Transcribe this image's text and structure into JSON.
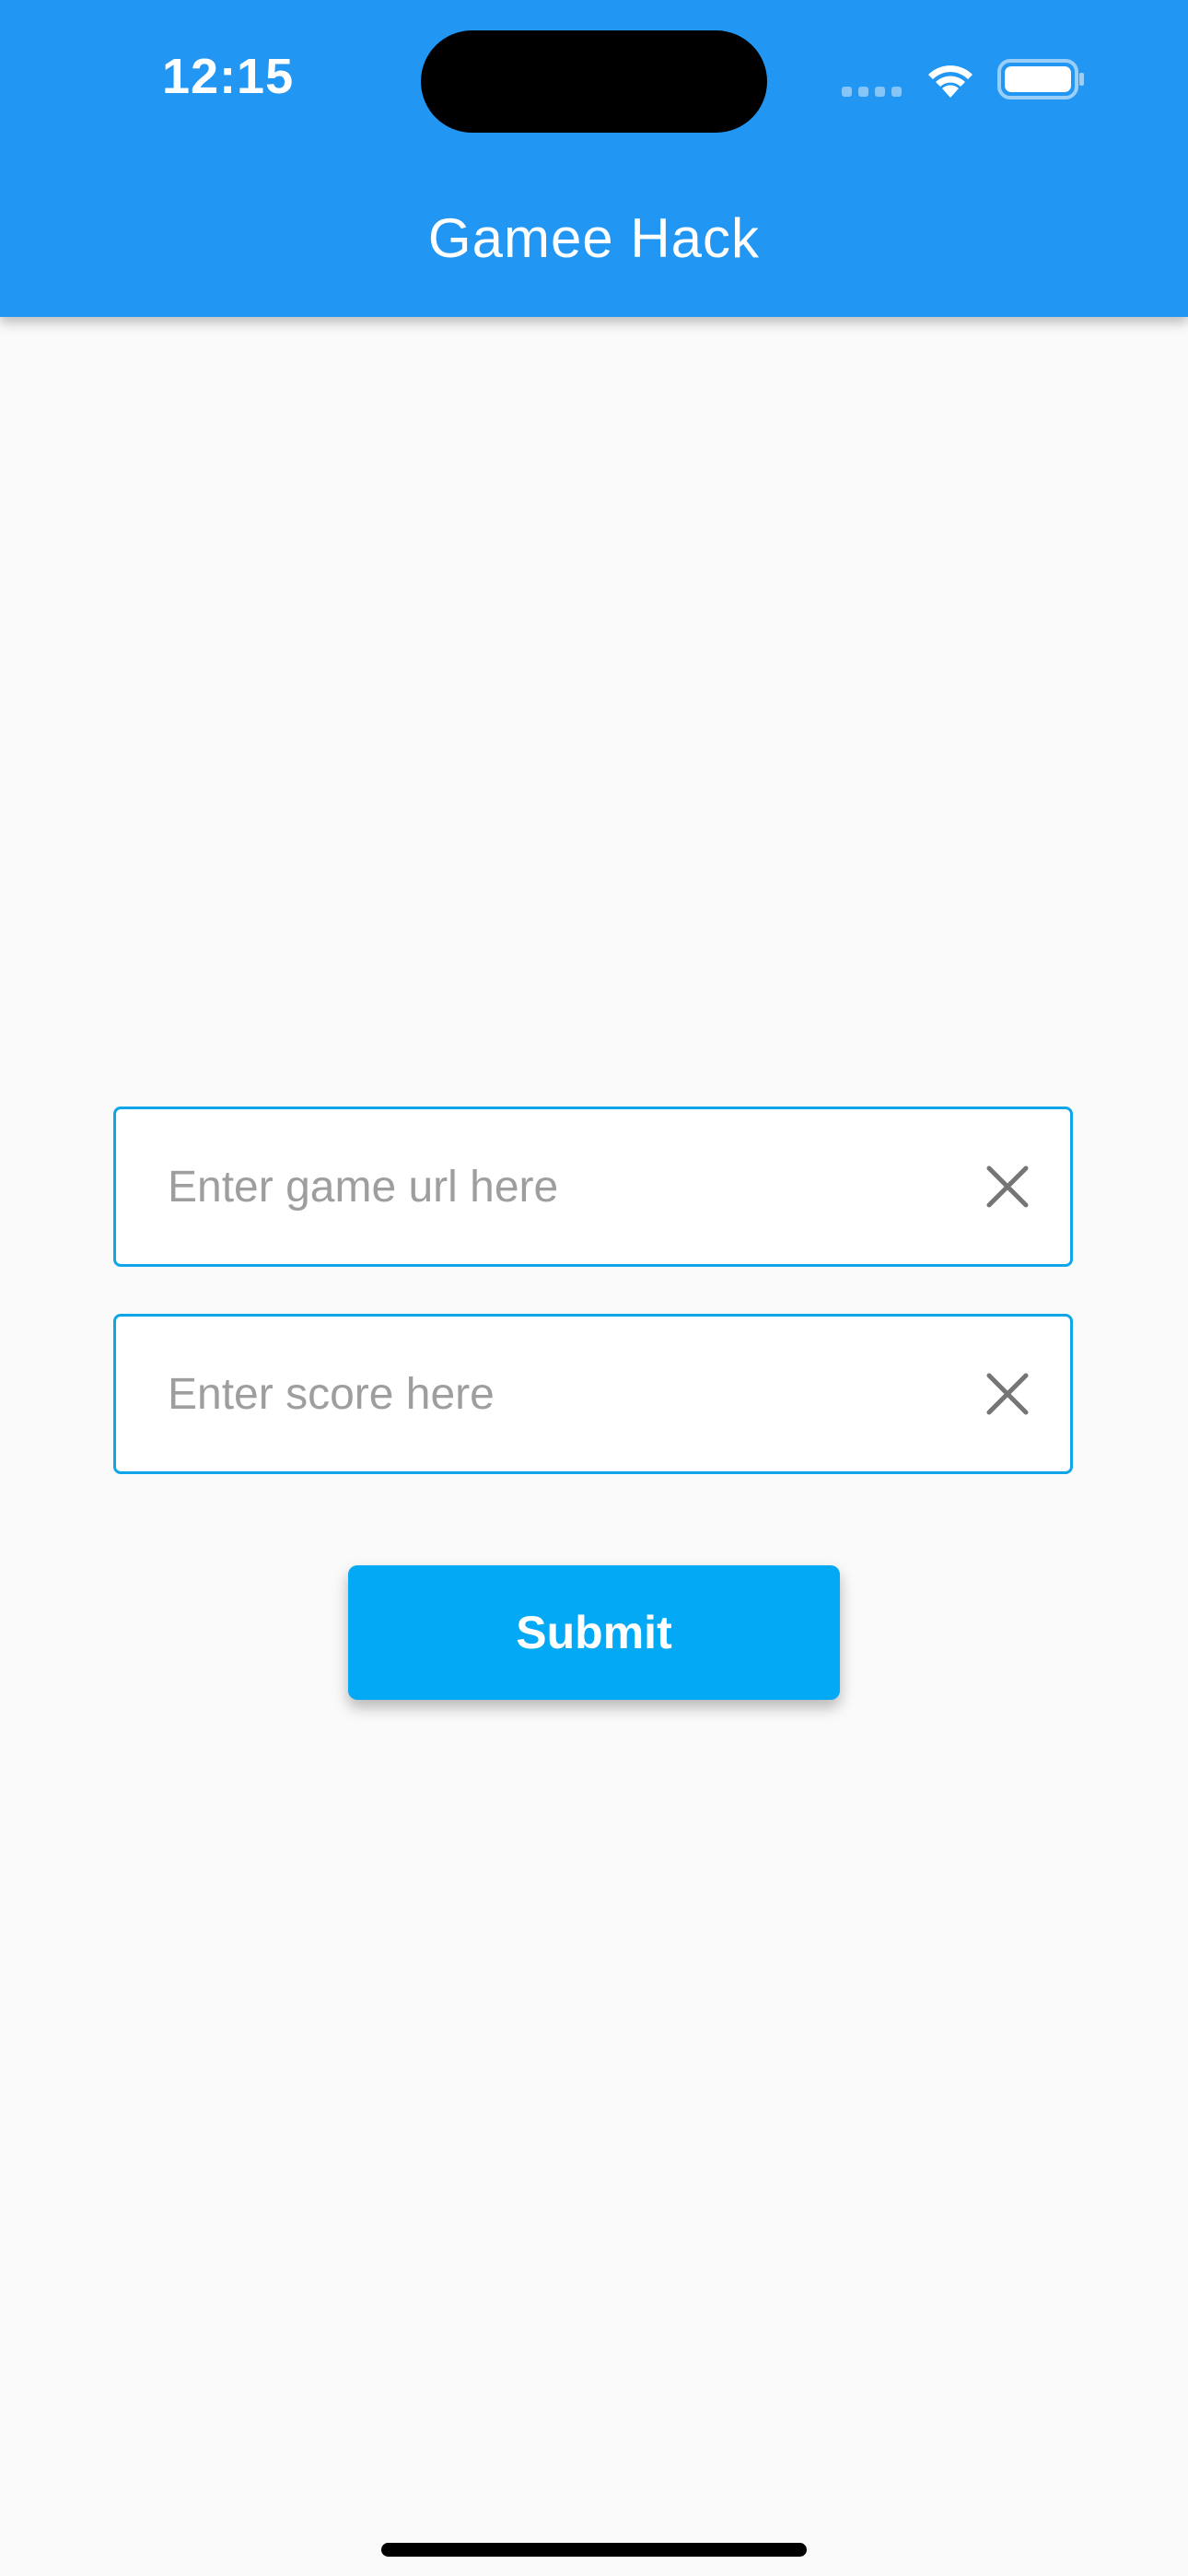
{
  "status_bar": {
    "time": "12:15"
  },
  "app_bar": {
    "title": "Gamee Hack",
    "color": "#2196f3"
  },
  "form": {
    "url_field": {
      "placeholder": "Enter game url here",
      "value": "",
      "clear_icon": "close-icon"
    },
    "score_field": {
      "placeholder": "Enter score here",
      "value": "",
      "clear_icon": "close-icon"
    },
    "submit_label": "Submit",
    "accent_color": "#03a9f4"
  }
}
